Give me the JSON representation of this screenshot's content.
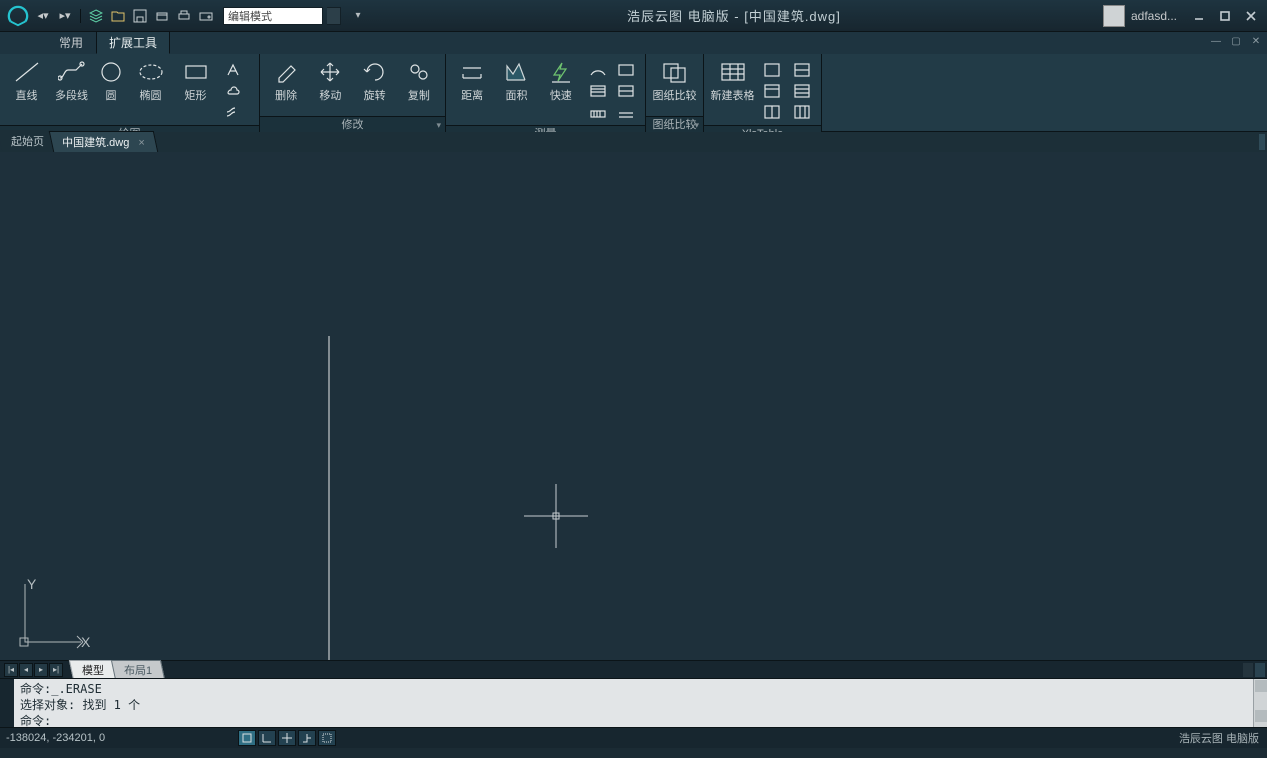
{
  "app_title": "浩辰云图 电脑版 - [中国建筑.dwg]",
  "user_name": "adfasd...",
  "mode_input": "编辑模式",
  "menu_tabs": {
    "common": "常用",
    "ext": "扩展工具"
  },
  "ribbon": {
    "draw": {
      "line": "直线",
      "polyline": "多段线",
      "circle": "圆",
      "ellipse": "椭圆",
      "rect": "矩形",
      "title": "绘图"
    },
    "modify": {
      "erase": "删除",
      "move": "移动",
      "rotate": "旋转",
      "copy": "复制",
      "title": "修改"
    },
    "measure": {
      "distance": "距离",
      "area": "面积",
      "quick": "快速",
      "title": "测量"
    },
    "compare": {
      "btn": "图纸比较",
      "title": "图纸比较"
    },
    "xlstable": {
      "btn": "新建表格",
      "title": "XlsTable"
    }
  },
  "doc_tabs": {
    "start": "起始页",
    "file": "中国建筑.dwg"
  },
  "layout_tabs": {
    "model": "模型",
    "layout1": "布局1"
  },
  "cmd": {
    "line1": "命令:_.ERASE",
    "line2": "选择对象: 找到 1 个",
    "line3": "命令:"
  },
  "status": {
    "coords": "-138024, -234201, 0",
    "product": "浩辰云图 电脑版"
  }
}
